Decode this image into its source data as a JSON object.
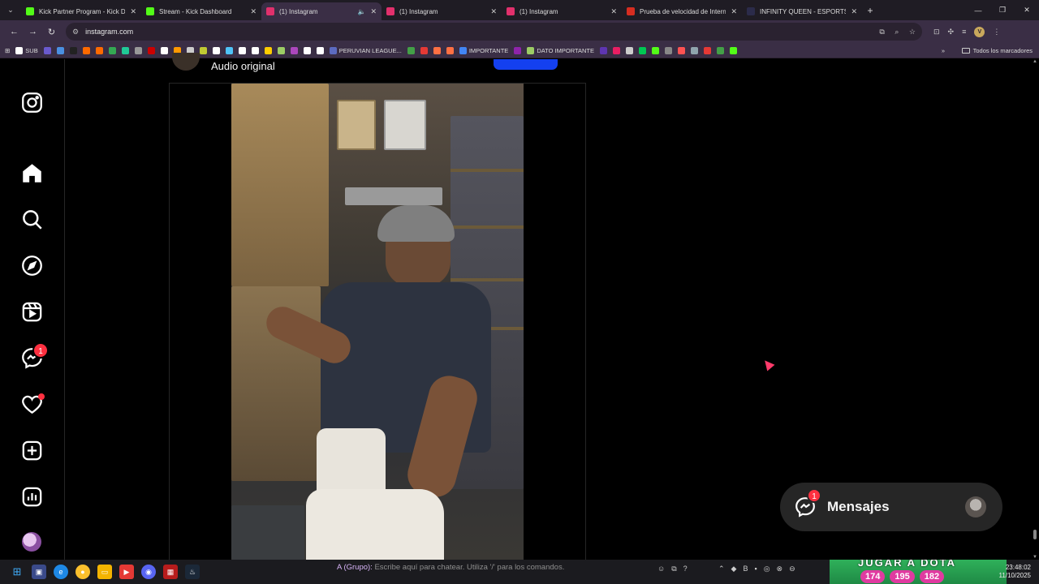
{
  "browser": {
    "tabs": [
      {
        "title": "Kick Partner Program - Kick Da",
        "favicon_color": "#53fc18",
        "active": false
      },
      {
        "title": "Stream - Kick Dashboard",
        "favicon_color": "#53fc18",
        "active": false
      },
      {
        "title": "(1) Instagram",
        "favicon_color": "#e1306c",
        "active": true
      },
      {
        "title": "(1) Instagram",
        "favicon_color": "#e1306c",
        "active": false
      },
      {
        "title": "(1) Instagram",
        "favicon_color": "#e1306c",
        "active": false
      },
      {
        "title": "Prueba de velocidad de Interne",
        "favicon_color": "#d62d20",
        "active": false
      },
      {
        "title": "INFINITY QUEEN - ESPORTS FE",
        "favicon_color": "#2b2b4a",
        "active": false
      }
    ],
    "url": "instagram.com",
    "profile_initial": "V",
    "bookmarks": [
      {
        "label": "SUB",
        "color": "#ffffff"
      },
      {
        "label": "",
        "color": "#6a5acd"
      },
      {
        "label": "",
        "color": "#4a90e2"
      },
      {
        "label": "",
        "color": "#222222"
      },
      {
        "label": "",
        "color": "#ff6a00"
      },
      {
        "label": "",
        "color": "#ff6a00"
      },
      {
        "label": "",
        "color": "#34a853"
      },
      {
        "label": "",
        "color": "#20c997"
      },
      {
        "label": "",
        "color": "#999999"
      },
      {
        "label": "",
        "color": "#cc0000"
      },
      {
        "label": "",
        "color": "#ffffff"
      },
      {
        "label": "",
        "color": "#ff9900"
      },
      {
        "label": "",
        "color": "#cccccc"
      },
      {
        "label": "",
        "color": "#c0ca33"
      },
      {
        "label": "",
        "color": "#ffffff"
      },
      {
        "label": "",
        "color": "#4fc3f7"
      },
      {
        "label": "",
        "color": "#ffffff"
      },
      {
        "label": "",
        "color": "#ffffff"
      },
      {
        "label": "",
        "color": "#ffcc00"
      },
      {
        "label": "",
        "color": "#9ccc65"
      },
      {
        "label": "",
        "color": "#ab47bc"
      },
      {
        "label": "",
        "color": "#ffffff"
      },
      {
        "label": "",
        "color": "#ffffff"
      },
      {
        "label": "PERUVIAN LEAGUE...",
        "color": "#5c6bc0"
      },
      {
        "label": "",
        "color": "#43a047"
      },
      {
        "label": "",
        "color": "#e53935"
      },
      {
        "label": "",
        "color": "#ff7043"
      },
      {
        "label": "",
        "color": "#ff7043"
      },
      {
        "label": "IMPORTANTE",
        "color": "#4285f4"
      },
      {
        "label": "",
        "color": "#8e24aa"
      },
      {
        "label": "DATO IMPORTANTE",
        "color": "#9ccc65"
      },
      {
        "label": "",
        "color": "#5e35b1"
      },
      {
        "label": "",
        "color": "#e91e63"
      },
      {
        "label": "",
        "color": "#cccccc"
      },
      {
        "label": "",
        "color": "#00c853"
      },
      {
        "label": "",
        "color": "#53fc18"
      },
      {
        "label": "",
        "color": "#888888"
      },
      {
        "label": "",
        "color": "#ff5252"
      },
      {
        "label": "",
        "color": "#90a4ae"
      },
      {
        "label": "",
        "color": "#e53935"
      },
      {
        "label": "",
        "color": "#43a047"
      },
      {
        "label": "",
        "color": "#53fc18"
      }
    ],
    "all_bookmarks_label": "Todos los marcadores"
  },
  "instagram": {
    "nav": [
      {
        "name": "instagram-logo-icon"
      },
      {
        "name": "home-icon"
      },
      {
        "name": "search-icon"
      },
      {
        "name": "explore-icon"
      },
      {
        "name": "reels-icon"
      },
      {
        "name": "messenger-icon",
        "badge": "1"
      },
      {
        "name": "heart-icon",
        "dot": true
      },
      {
        "name": "create-icon"
      },
      {
        "name": "dashboard-icon"
      }
    ],
    "post": {
      "audio_label": "Audio original"
    },
    "messages": {
      "label": "Mensajes",
      "badge": "1"
    },
    "colors": {
      "accent": "#0095f6",
      "badge": "#ff3040",
      "follow_button": "#1440f0"
    }
  },
  "taskbar": {
    "chat_who": "A (Grupo):",
    "chat_hint": "Escribe aquí para chatear. Utiliza '/' para los comandos.",
    "banner_text": "JUGAR A DOTA",
    "stats": [
      "174",
      "195",
      "182"
    ],
    "time": "23:48:02",
    "date": "11/10/2025"
  }
}
